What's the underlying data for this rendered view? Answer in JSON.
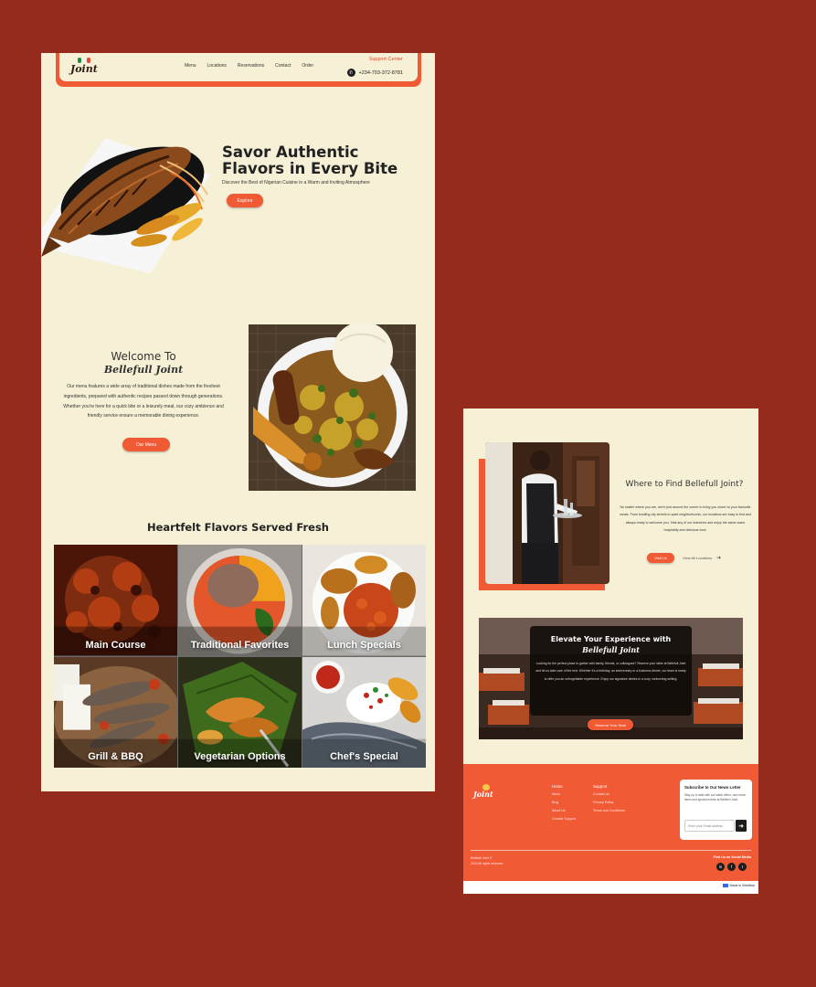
{
  "colors": {
    "background": "#952b1c",
    "cream": "#f6f1d6",
    "accent": "#f05a35",
    "dark": "#1c1c1c"
  },
  "brand": {
    "logo_text": "Joint",
    "script_name": "Bellefull Joint"
  },
  "nav": {
    "links": [
      "Menu",
      "Locations",
      "Reservations",
      "Contact",
      "Order"
    ],
    "support_label": "Support Center",
    "phone": "+234-703-372-8781",
    "phone_icon": "phone-icon"
  },
  "hero": {
    "title": "Savor Authentic Flavors in Every Bite",
    "subtitle": "Discover the Best of Nigerian Cuisine in a Warm and Inviting Atmosphere",
    "button": "Explore"
  },
  "welcome": {
    "title": "Welcome To",
    "script": "Bellefull Joint",
    "body": "Our menu features a wide array of traditional dishes made from the freshest ingredients, prepared with authentic recipes passed down through generations. Whether you're here for a quick bite or a leisurely meal, our cozy ambience and friendly service ensure a memorable dining experience.",
    "button": "Our Menu"
  },
  "menu_section": {
    "title": "Heartfelt Flavors Served Fresh",
    "tiles": [
      {
        "label": "Main Course"
      },
      {
        "label": "Traditional Favorites"
      },
      {
        "label": "Lunch Specials"
      },
      {
        "label": "Grill & BBQ"
      },
      {
        "label": "Vegetarian Options"
      },
      {
        "label": "Chef's Special"
      }
    ]
  },
  "find": {
    "title": "Where to Find Bellefull Joint?",
    "body": "No matter where you are, we're just around the corner to bring you closer to your favourite meals. From bustling city streets to quiet neighborhoods, our locations are easy to find and always ready to welcome you. Visit any of our branches and enjoy the same warm hospitality and delicious food.",
    "button": "Visit Us",
    "link": "View All Locations",
    "link_icon": "arrow-right-icon"
  },
  "elevate": {
    "title": "Elevate Your Experience with",
    "script": "Bellefull Joint",
    "body": "Looking for the perfect place to gather with family, friends, or colleagues? Reserve your table at Bellefull Joint and let us take care of the rest. Whether it's a birthday, an anniversary or a business dinner, our team is ready to offer you an unforgettable experience. Enjoy our signature dishes in a cozy, welcoming setting.",
    "button": "Reserve Your Seat"
  },
  "footer": {
    "logo_text": "Joint",
    "col1": {
      "heading": "Home",
      "items": [
        "Menu",
        "Blog",
        "About Us",
        "Contact Support"
      ]
    },
    "col2": {
      "heading": "Support",
      "items": [
        "Contact Us",
        "Privacy Policy",
        "Terms and Conditions"
      ]
    },
    "newsletter": {
      "title": "Subscribe to Our News Letter",
      "body": "Stay up to date with our latest offers, new menu items and special events at Bellefull Joint.",
      "placeholder": "Enter your Email address",
      "send_icon": "arrow-right-icon"
    },
    "copyright_1": "Bellefull Joint ©",
    "copyright_2": "2024 All rights reserved",
    "follow_label": "Find Us on Social Media",
    "social_icons": [
      "linkedin-icon",
      "facebook-icon",
      "twitter-icon"
    ],
    "made_with": "Made in Webflow"
  }
}
